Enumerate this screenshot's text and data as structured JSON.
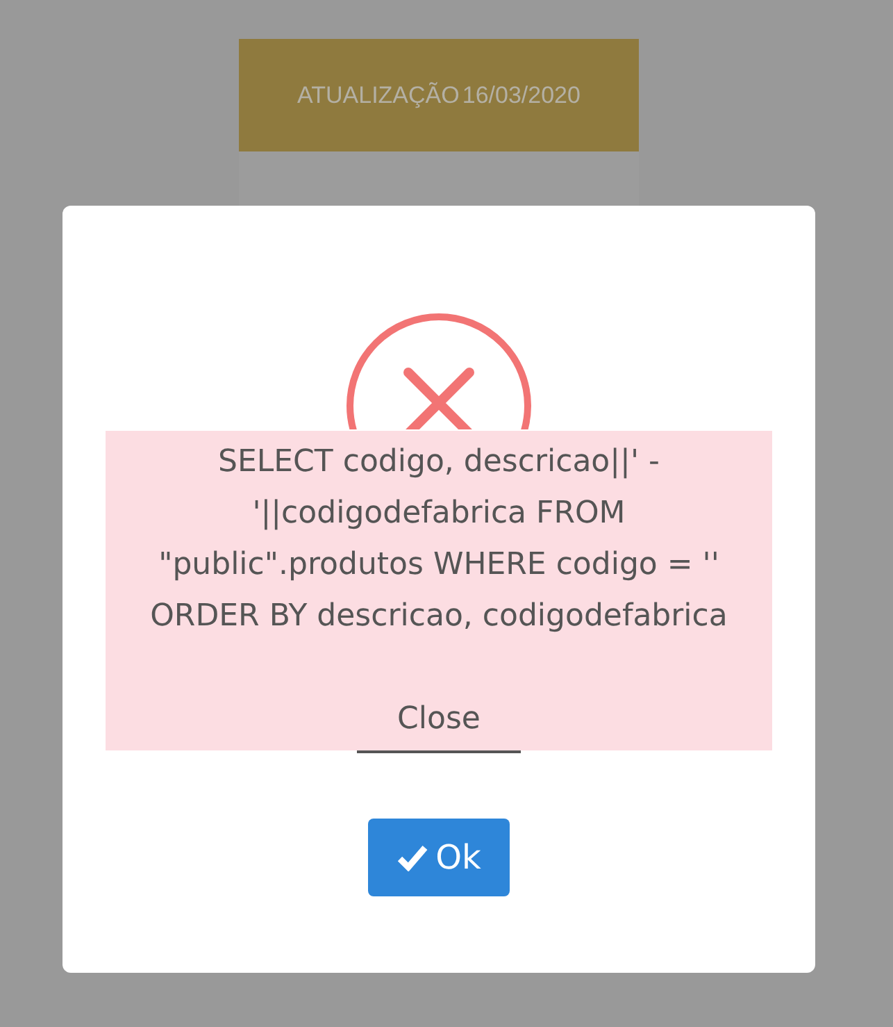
{
  "background_card": {
    "header_label": "ATUALIZAÇÃO",
    "header_date": "16/03/2020"
  },
  "modal": {
    "error_lines": [
      "SELECT codigo, descricao||' -",
      "'||codigodefabrica FROM",
      "\"public\".produtos WHERE codigo = ''",
      "ORDER BY descricao, codigodefabrica"
    ],
    "close_link": "Close",
    "ok_button": "Ok"
  }
}
